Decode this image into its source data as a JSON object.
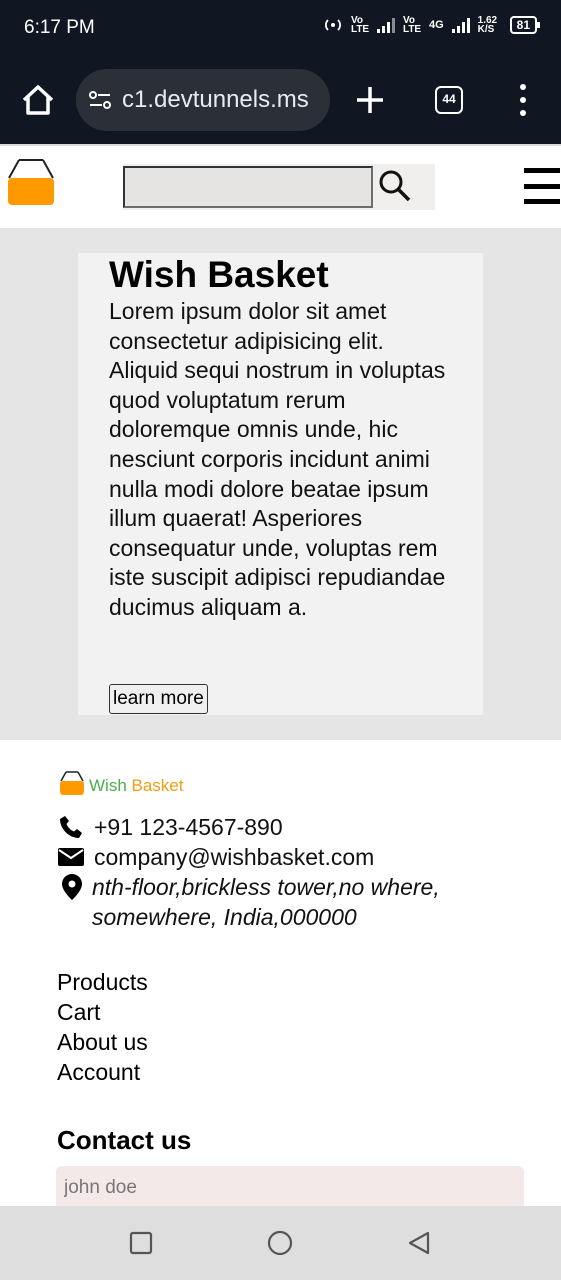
{
  "status_bar": {
    "time": "6:17 PM",
    "net1": "Vo LTE",
    "net2": "Vo LTE",
    "net3": "4G",
    "speed": "1.62 K/S",
    "battery": "81"
  },
  "browser": {
    "url_visible": "c1.devtunnels.ms",
    "tab_count": "44"
  },
  "site": {
    "search_placeholder": "",
    "hero": {
      "title": "Wish Basket",
      "body": "Lorem ipsum dolor sit amet consectetur adipisicing elit. Aliquid sequi nostrum in voluptas quod voluptatum rerum doloremque omnis unde, hic nesciunt corporis incidunt animi nulla modi dolore beatae ipsum illum quaerat! Asperiores consequatur unde, voluptas rem iste suscipit adipisci repudiandae ducimus aliquam a.",
      "button": "learn more"
    },
    "footer": {
      "brand_word1": "Wish",
      "brand_word2": "Basket",
      "phone": "+91 123-4567-890",
      "email": "company@wishbasket.com",
      "address": "nth-floor,brickless tower,no where, somewhere, India,000000",
      "links": [
        "Products",
        "Cart",
        "About us",
        "Account"
      ],
      "contact_title": "Contact us",
      "name_placeholder": "john doe"
    }
  },
  "colors": {
    "accent_orange": "#ff9900",
    "brand_green": "#4cae4c",
    "brand_orange": "#f39c12",
    "chrome_dark": "#111722"
  },
  "icons": {
    "browser": [
      "home-icon",
      "tune-icon",
      "plus-icon",
      "tabs-icon",
      "more-vert-icon"
    ],
    "site": [
      "basket-logo-icon",
      "search-icon",
      "hamburger-icon",
      "phone-icon",
      "envelope-icon",
      "map-pin-icon"
    ],
    "nav": [
      "square-icon",
      "circle-icon",
      "back-triangle-icon"
    ]
  }
}
